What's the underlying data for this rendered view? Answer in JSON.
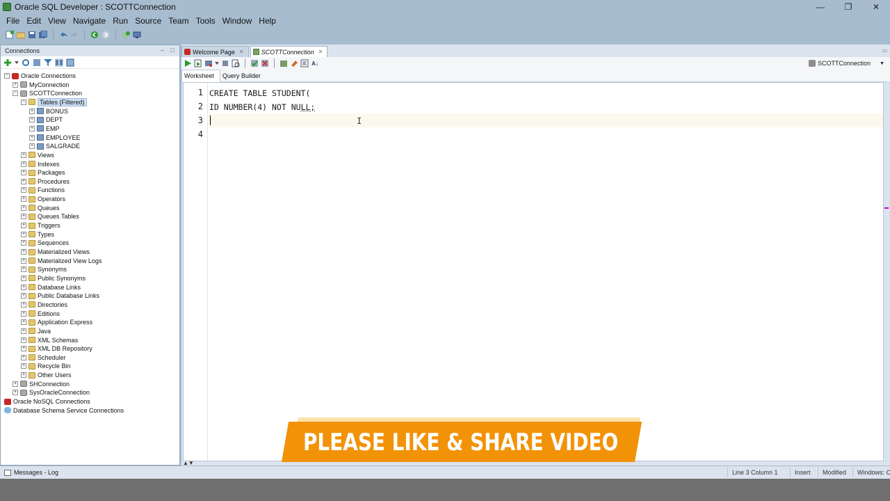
{
  "window": {
    "title": "Oracle SQL Developer : SCOTTConnection",
    "minimize": "—",
    "restore": "❐",
    "close": "✕"
  },
  "menu": [
    "File",
    "Edit",
    "View",
    "Navigate",
    "Run",
    "Source",
    "Team",
    "Tools",
    "Window",
    "Help"
  ],
  "connections_panel": {
    "title": "Connections",
    "minimize": "–",
    "restore": "□",
    "tree": [
      {
        "label": "Oracle Connections",
        "level": 0,
        "icon": "oracle",
        "exp": "minus"
      },
      {
        "label": "MyConnection",
        "level": 1,
        "icon": "db",
        "exp": "plus"
      },
      {
        "label": "SCOTTConnection",
        "level": 1,
        "icon": "db",
        "exp": "minus"
      },
      {
        "label": "Tables (Filtered)",
        "level": 2,
        "icon": "folder",
        "exp": "minus",
        "selected": true
      },
      {
        "label": "BONUS",
        "level": 3,
        "icon": "table",
        "exp": "plus"
      },
      {
        "label": "DEPT",
        "level": 3,
        "icon": "table",
        "exp": "plus"
      },
      {
        "label": "EMP",
        "level": 3,
        "icon": "table",
        "exp": "plus"
      },
      {
        "label": "EMPLOYEE",
        "level": 3,
        "icon": "table",
        "exp": "plus"
      },
      {
        "label": "SALGRADE",
        "level": 3,
        "icon": "table",
        "exp": "plus"
      },
      {
        "label": "Views",
        "level": 2,
        "icon": "folder",
        "exp": "plus"
      },
      {
        "label": "Indexes",
        "level": 2,
        "icon": "folder",
        "exp": "plus"
      },
      {
        "label": "Packages",
        "level": 2,
        "icon": "folder",
        "exp": "plus"
      },
      {
        "label": "Procedures",
        "level": 2,
        "icon": "folder",
        "exp": "plus"
      },
      {
        "label": "Functions",
        "level": 2,
        "icon": "folder",
        "exp": "plus"
      },
      {
        "label": "Operators",
        "level": 2,
        "icon": "folder",
        "exp": "plus"
      },
      {
        "label": "Queues",
        "level": 2,
        "icon": "folder",
        "exp": "plus"
      },
      {
        "label": "Queues Tables",
        "level": 2,
        "icon": "folder",
        "exp": "plus"
      },
      {
        "label": "Triggers",
        "level": 2,
        "icon": "folder",
        "exp": "plus"
      },
      {
        "label": "Types",
        "level": 2,
        "icon": "folder",
        "exp": "plus"
      },
      {
        "label": "Sequences",
        "level": 2,
        "icon": "folder",
        "exp": "plus"
      },
      {
        "label": "Materialized Views",
        "level": 2,
        "icon": "folder",
        "exp": "plus"
      },
      {
        "label": "Materialized View Logs",
        "level": 2,
        "icon": "folder",
        "exp": "plus"
      },
      {
        "label": "Synonyms",
        "level": 2,
        "icon": "folder",
        "exp": "plus"
      },
      {
        "label": "Public Synonyms",
        "level": 2,
        "icon": "folder",
        "exp": "plus"
      },
      {
        "label": "Database Links",
        "level": 2,
        "icon": "folder",
        "exp": "plus"
      },
      {
        "label": "Public Database Links",
        "level": 2,
        "icon": "folder",
        "exp": "plus"
      },
      {
        "label": "Directories",
        "level": 2,
        "icon": "folder",
        "exp": "plus"
      },
      {
        "label": "Editions",
        "level": 2,
        "icon": "folder",
        "exp": "plus"
      },
      {
        "label": "Application Express",
        "level": 2,
        "icon": "folder",
        "exp": "plus"
      },
      {
        "label": "Java",
        "level": 2,
        "icon": "folder",
        "exp": "plus"
      },
      {
        "label": "XML Schemas",
        "level": 2,
        "icon": "folder",
        "exp": "plus"
      },
      {
        "label": "XML DB Repository",
        "level": 2,
        "icon": "folder",
        "exp": "plus"
      },
      {
        "label": "Scheduler",
        "level": 2,
        "icon": "folder",
        "exp": "plus"
      },
      {
        "label": "Recycle Bin",
        "level": 2,
        "icon": "folder",
        "exp": "plus"
      },
      {
        "label": "Other Users",
        "level": 2,
        "icon": "folder",
        "exp": "plus"
      },
      {
        "label": "SHConnection",
        "level": 1,
        "icon": "db",
        "exp": "plus"
      },
      {
        "label": "SysOracleConnection",
        "level": 1,
        "icon": "db",
        "exp": "plus"
      },
      {
        "label": "Oracle NoSQL Connections",
        "level": 0,
        "icon": "oracle",
        "exp": "none"
      },
      {
        "label": "Database Schema Service Connections",
        "level": 0,
        "icon": "cloud",
        "exp": "none"
      }
    ]
  },
  "editor_tabs": [
    {
      "label": "Welcome Page",
      "active": false
    },
    {
      "label": "SCOTTConnection",
      "active": true
    }
  ],
  "connection_selector": "SCOTTConnection",
  "sub_tabs": [
    {
      "label": "Worksheet",
      "active": true
    },
    {
      "label": "Query Builder",
      "active": false
    }
  ],
  "code": {
    "lines": [
      "CREATE TABLE STUDENT(",
      "ID NUMBER(4) NOT NULL;",
      "",
      ""
    ],
    "line_numbers": [
      "1",
      "2",
      "3",
      "4"
    ]
  },
  "banner": {
    "text": "PLEASE LIKE & SHARE VIDEO"
  },
  "status": {
    "messages": "Messages - Log",
    "position": "Line 3 Column 1",
    "mode": "Insert",
    "state": "Modified",
    "eol": "Windows: CR"
  },
  "colors": {
    "chrome": "#a7bccf",
    "banner": "#f29207",
    "current_line": "#fbf9ee"
  }
}
